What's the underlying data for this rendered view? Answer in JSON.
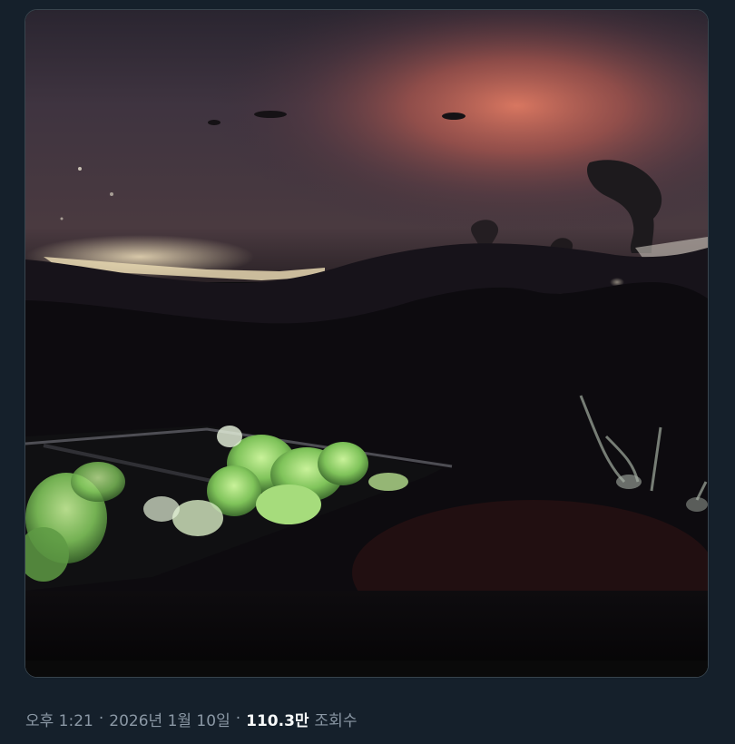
{
  "tweet": {
    "time": "오후 1:21",
    "separator": "·",
    "date": "2026년 1월 10일",
    "views_count": "110.3만",
    "views_label": "조회수"
  },
  "media": {
    "type": "video",
    "scene": "night-explosion-over-city",
    "colors": {
      "sky_glow": "#c56a5c",
      "sky_dark": "#3a3340",
      "foliage": "#8fcf6a",
      "background": "#15202b",
      "muted_text": "#8b98a5"
    }
  }
}
